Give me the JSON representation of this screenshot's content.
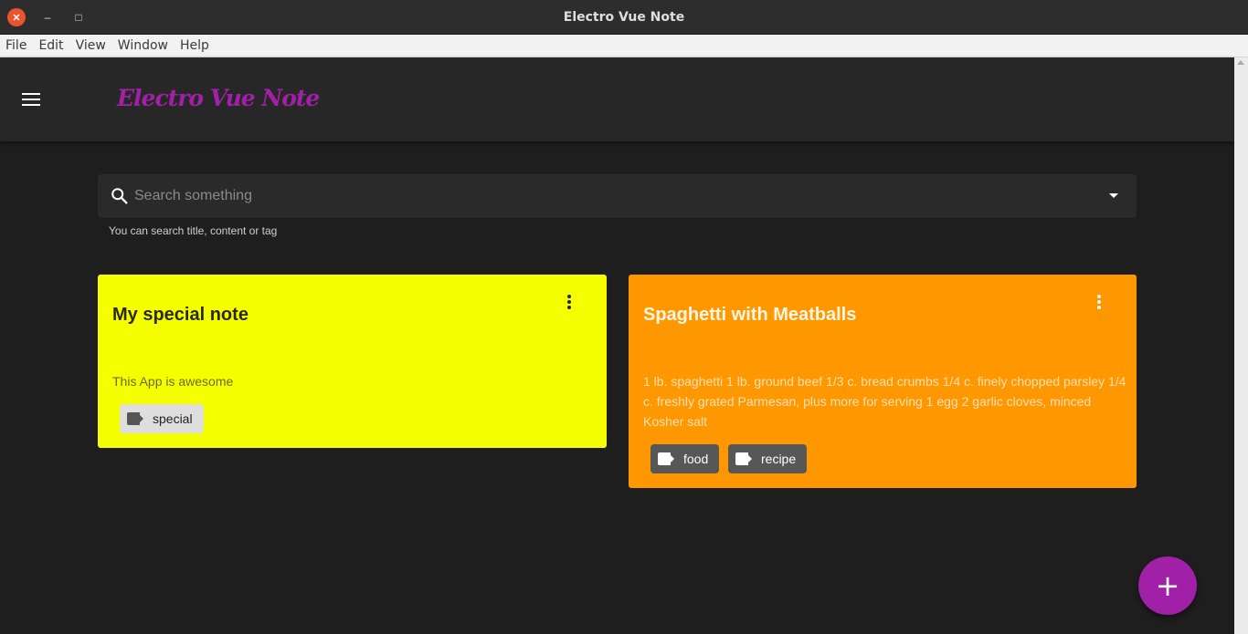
{
  "window": {
    "title": "Electro Vue Note"
  },
  "menu": [
    "File",
    "Edit",
    "View",
    "Window",
    "Help"
  ],
  "appbar": {
    "brand": "Electro Vue Note"
  },
  "search": {
    "placeholder": "Search something",
    "hint": "You can search title, content or tag"
  },
  "notes": [
    {
      "title": "My special note",
      "content": "This App is awesome",
      "color": "#f6ff00",
      "tags": [
        "special"
      ]
    },
    {
      "title": "Spaghetti with Meatballs",
      "content": "1 lb. spaghetti 1 lb. ground beef 1/3 c. bread crumbs 1/4 c. finely chopped parsley 1/4 c. freshly grated Parmesan, plus more for serving 1 egg 2 garlic cloves, minced Kosher salt",
      "color": "#ff9800",
      "tags": [
        "food",
        "recipe"
      ]
    }
  ],
  "fab": {
    "label": "+",
    "color": "#a020a8"
  },
  "icons": {
    "close": "close-icon",
    "minimize": "minimize-icon",
    "maximize": "maximize-icon",
    "menu": "hamburger-icon",
    "search": "search-icon",
    "dropdown": "caret-down-icon",
    "more": "more-vert-icon",
    "tag": "tag-icon",
    "add": "plus-icon"
  }
}
